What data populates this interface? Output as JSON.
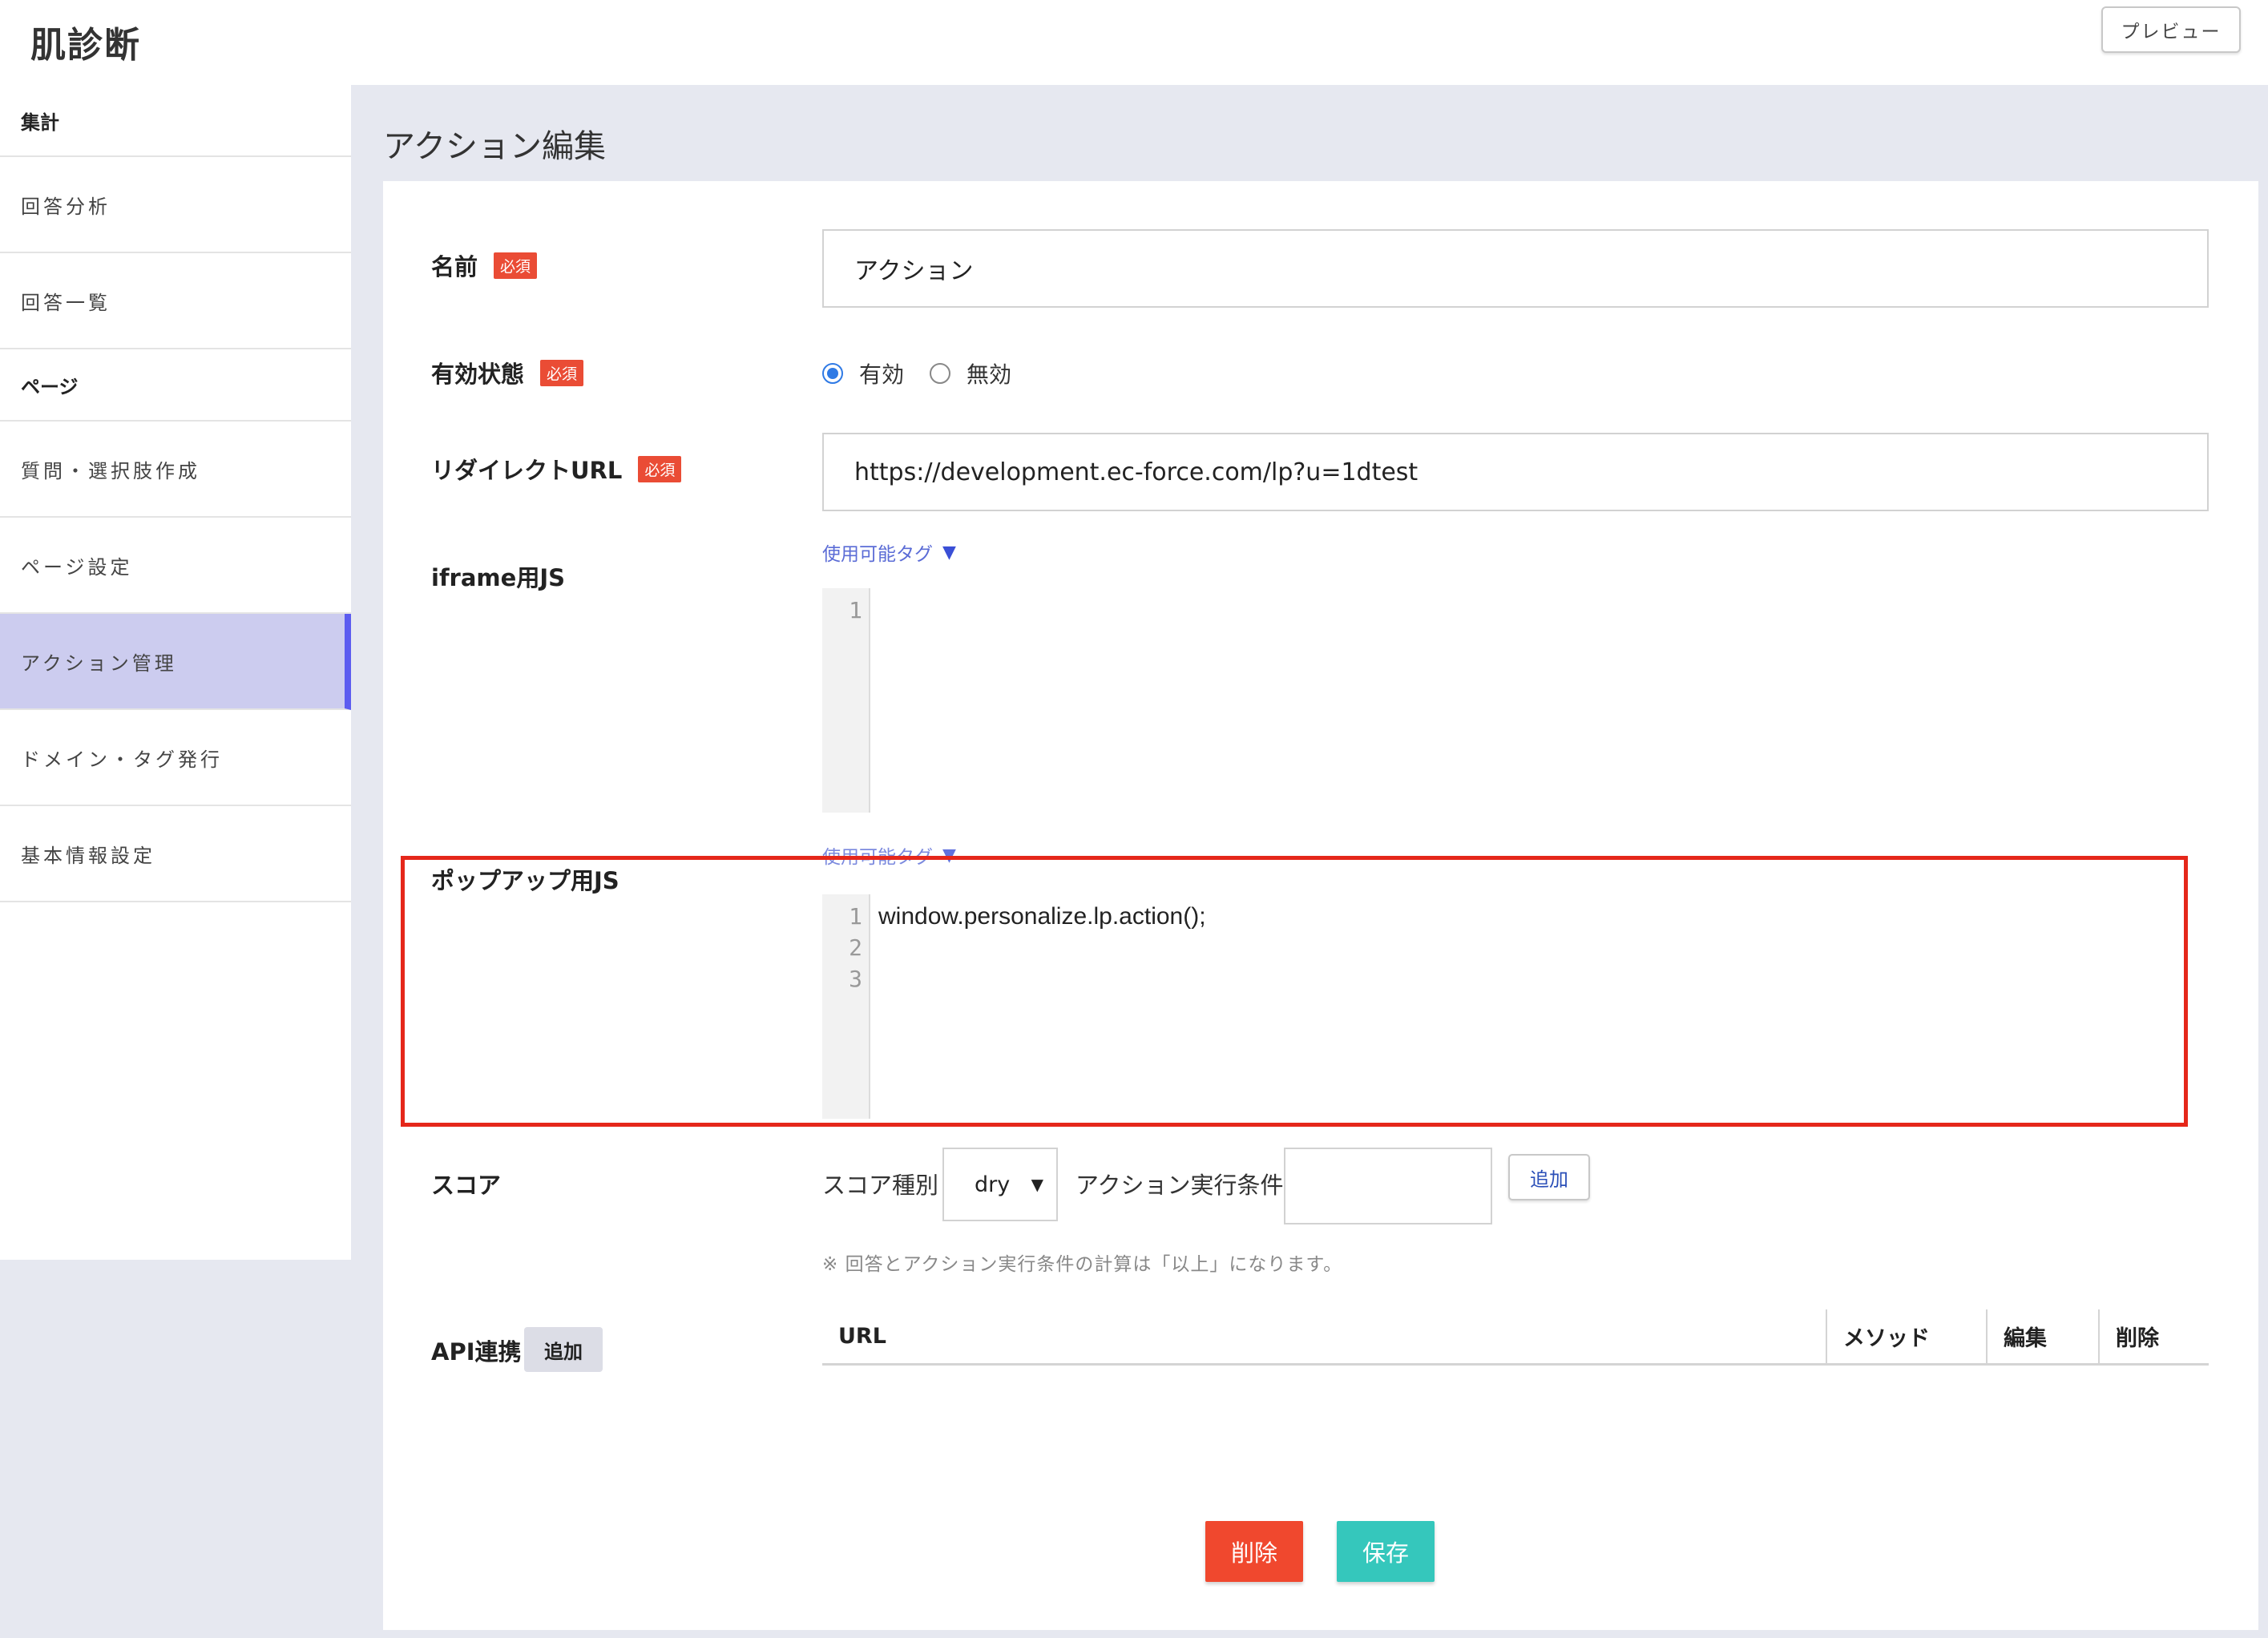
{
  "header": {
    "app_title": "肌診断",
    "preview_label": "プレビュー"
  },
  "sidebar": {
    "section_stats": "集計",
    "item_answer_analysis": "回答分析",
    "item_answer_list": "回答一覧",
    "section_pages": "ページ",
    "item_question_create": "質問・選択肢作成",
    "item_page_settings": "ページ設定",
    "item_action_manage": "アクション管理",
    "item_domain_tag": "ドメイン・タグ発行",
    "item_basic_info": "基本情報設定"
  },
  "page": {
    "heading": "アクション編集"
  },
  "form": {
    "required_badge": "必須",
    "name_label": "名前",
    "name_value": "アクション",
    "status_label": "有効状態",
    "status_enabled": "有効",
    "status_disabled": "無効",
    "redirect_label": "リダイレクトURL",
    "redirect_value": "https://development.ec-force.com/lp?u=1dtest",
    "usable_tags": "使用可能タグ",
    "iframe_js_label": "iframe用JS",
    "iframe_js_lines": [
      "1"
    ],
    "iframe_js_code": "",
    "popup_js_label": "ポップアップ用JS",
    "popup_js_lines": [
      "1",
      "2",
      "3"
    ],
    "popup_js_code": "window.personalize.lp.action();",
    "score_label": "スコア",
    "score_type_label": "スコア種別",
    "score_type_value": "dry",
    "action_condition_label": "アクション実行条件",
    "action_condition_value": "",
    "score_add_button": "追加",
    "score_note": "※ 回答とアクション実行条件の計算は「以上」になります。",
    "api_label": "API連携",
    "api_add_button": "追加",
    "api_table": {
      "col_url": "URL",
      "col_method": "メソッド",
      "col_edit": "編集",
      "col_delete": "削除"
    }
  },
  "buttons": {
    "delete": "削除",
    "save": "保存"
  },
  "colors": {
    "accent": "#5c5cf0",
    "danger": "#f0482e",
    "save": "#35c7bc",
    "required": "#ea4c35",
    "highlight": "#e5271a"
  }
}
